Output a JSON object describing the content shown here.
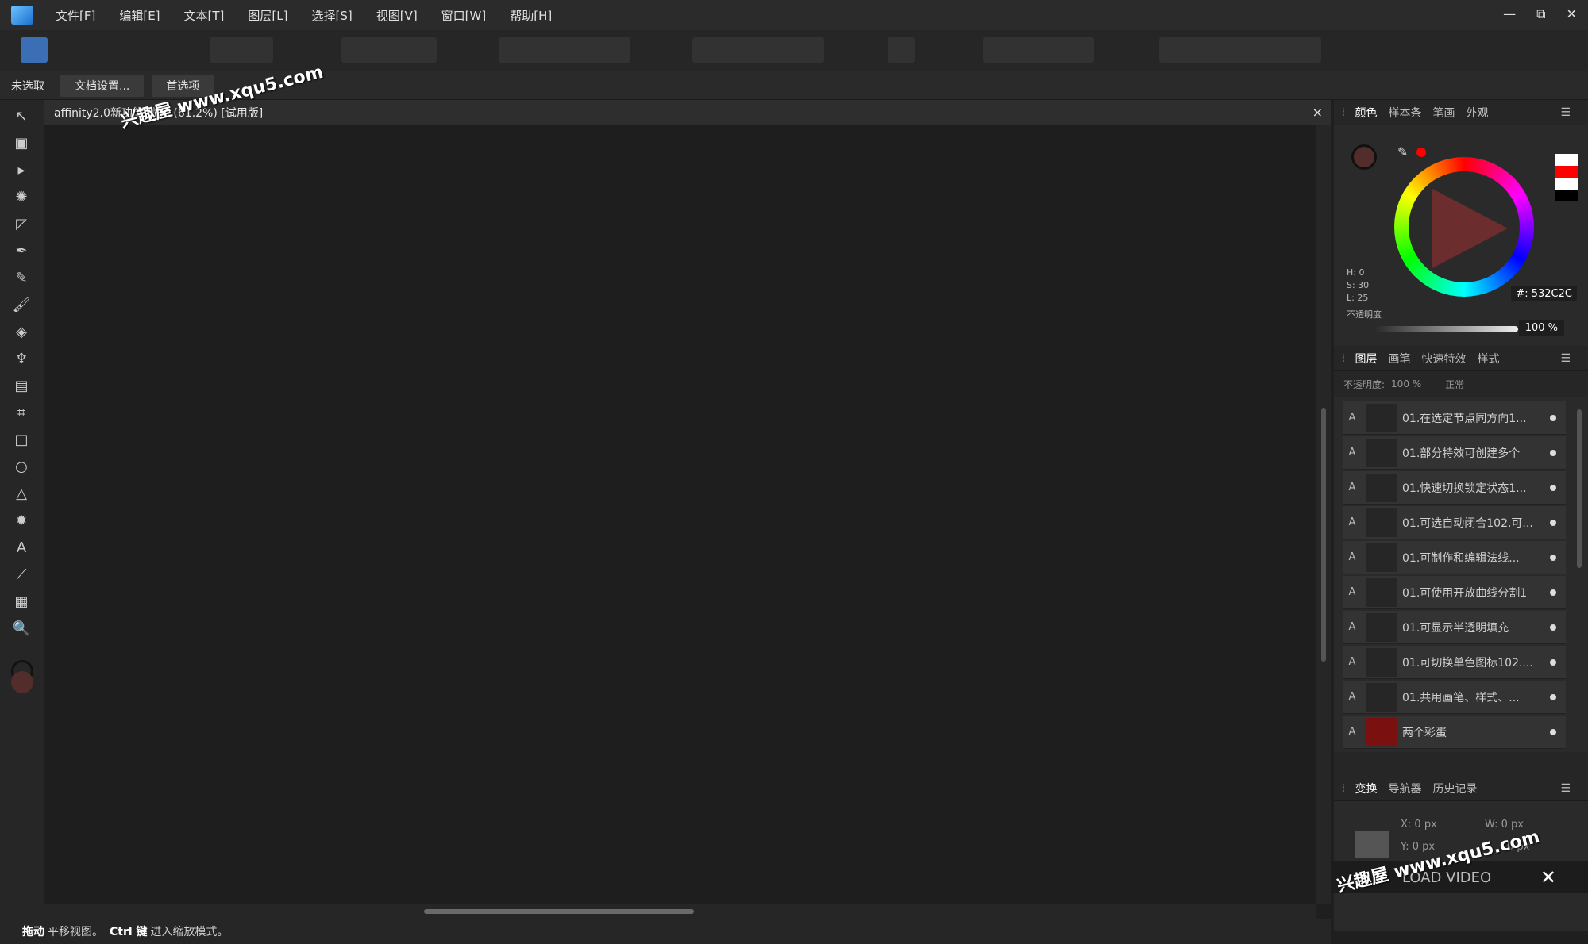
{
  "menubar": {
    "items": [
      "文件[F]",
      "编辑[E]",
      "文本[T]",
      "图层[L]",
      "选择[S]",
      "视图[V]",
      "窗口[W]",
      "帮助[H]"
    ],
    "min": "—",
    "restore": "⧉",
    "close": "✕"
  },
  "context": {
    "status": "未选取",
    "doc_settings": "文档设置...",
    "prefs": "首选项"
  },
  "doc": {
    "tab_title": "affinity2.0新功能-优化 (61.2%) [试用版]",
    "close": "×"
  },
  "statusbar": {
    "k1": "拖动",
    "t1": "平移视图。",
    "k2": "Ctrl 键",
    "t2": "进入缩放模式。"
  },
  "colorpanel": {
    "tabs": [
      "颜色",
      "样本条",
      "笔画",
      "外观"
    ],
    "hsl": [
      "H: 0",
      "S: 30",
      "L: 25"
    ],
    "hex": "#: 532C2C",
    "opacity_label": "不透明度",
    "opacity_value": "100 %",
    "accent": "#532C2C"
  },
  "layerspanel": {
    "tabs": [
      "图层",
      "画笔",
      "快速特效",
      "样式"
    ],
    "opacity_label": "不透明度:",
    "opacity_value": "100 %",
    "blend": "正常",
    "layers": [
      {
        "a": "A",
        "name": "01.在选定节点同方向1..."
      },
      {
        "a": "A",
        "name": "01.部分特效可创建多个"
      },
      {
        "a": "A",
        "name": "01.快速切换锁定状态1..."
      },
      {
        "a": "A",
        "name": "01.可选自动闭合102.可..."
      },
      {
        "a": "A",
        "name": "01.可制作和编辑法线..."
      },
      {
        "a": "A",
        "name": "01.可使用开放曲线分割1"
      },
      {
        "a": "A",
        "name": "01.可显示半透明填充"
      },
      {
        "a": "A",
        "name": "01.可切换单色图标102...."
      },
      {
        "a": "A",
        "name": "01.共用画笔、样式、..."
      },
      {
        "a": "A",
        "name": "两个彩蛋"
      }
    ]
  },
  "transformpanel": {
    "tabs": [
      "变换",
      "导航器",
      "历史记录"
    ],
    "x": "X:  0 px",
    "y": "Y:  0 px",
    "w": "W:  0 px",
    "h": "0 px"
  },
  "video": {
    "label": "LOAD VIDEO",
    "close": "✕"
  },
  "watermark": "兴趣屋 www.xqu5.com"
}
